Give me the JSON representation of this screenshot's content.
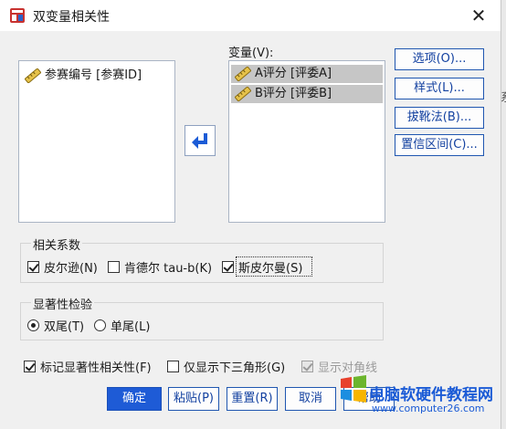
{
  "window": {
    "title": "双变量相关性",
    "close_glyph": "✕"
  },
  "source_list": {
    "items": [
      "参赛编号 [参赛ID]"
    ]
  },
  "variables": {
    "label": "变量(V):",
    "items": [
      "A评分 [评委A]",
      "B评分 [评委B]"
    ]
  },
  "side_buttons": {
    "options": "选项(O)...",
    "style": "样式(L)...",
    "bootstrap": "拔靴法(B)...",
    "ci": "置信区间(C)..."
  },
  "correlation": {
    "title": "相关系数",
    "pearson": {
      "label": "皮尔逊(N)",
      "checked": true
    },
    "kendall": {
      "label": "肯德尔 tau-b(K)",
      "checked": false
    },
    "spearman": {
      "label": "斯皮尔曼(S)",
      "checked": true
    }
  },
  "significance": {
    "title": "显著性检验",
    "two_tailed": {
      "label": "双尾(T)",
      "selected": true
    },
    "one_tailed": {
      "label": "单尾(L)",
      "selected": false
    }
  },
  "options_row": {
    "flag": {
      "label": "标记显著性相关性(F)",
      "checked": true
    },
    "lower": {
      "label": "仅显示下三角形(G)",
      "checked": false
    },
    "diagonal": {
      "label": "显示对角线",
      "checked": true,
      "disabled": true
    }
  },
  "buttons": {
    "ok": "确定",
    "paste": "粘贴(P)",
    "reset": "重置(R)",
    "cancel": "取消",
    "help": "帮助"
  },
  "watermark": {
    "text": "电脑软硬件教程网",
    "url": "www.computer26.com"
  },
  "background_fragment": "系",
  "colors": {
    "accent": "#1e5bd6",
    "selection": "#c6c6c6",
    "link": "#1240a0"
  }
}
